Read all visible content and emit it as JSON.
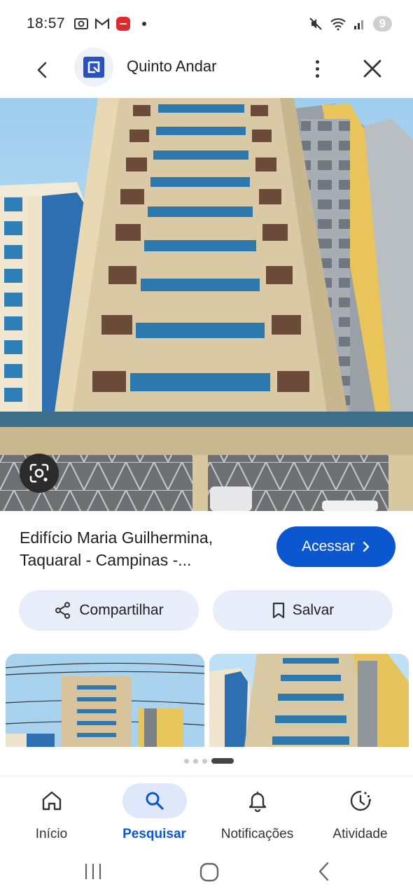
{
  "status_bar": {
    "time": "18:57",
    "battery": "9"
  },
  "header": {
    "site_title": "Quinto Andar"
  },
  "result": {
    "title": "Edifício Maria Guilhermina, Taquaral - Campinas -...",
    "visit_label": "Acessar"
  },
  "actions": {
    "share_label": "Compartilhar",
    "save_label": "Salvar"
  },
  "bottom_nav": {
    "items": [
      {
        "label": "Início",
        "icon": "home-icon"
      },
      {
        "label": "Pesquisar",
        "icon": "search-icon",
        "active": true
      },
      {
        "label": "Notificações",
        "icon": "bell-icon"
      },
      {
        "label": "Atividade",
        "icon": "activity-icon"
      }
    ]
  },
  "colors": {
    "accent": "#0b57d0",
    "chip_bg": "#e7eef9",
    "active_nav_bg": "#dfe8fb"
  }
}
